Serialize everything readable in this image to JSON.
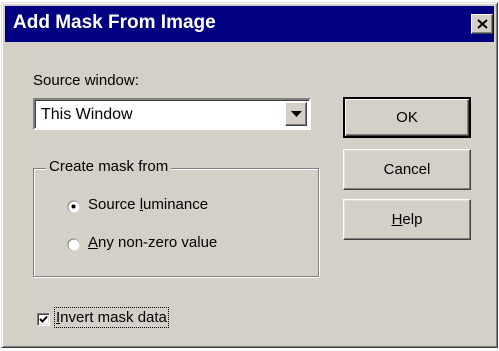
{
  "window": {
    "title": "Add Mask From Image",
    "close_icon": "close-x-icon"
  },
  "source": {
    "label": "Source window:",
    "selected": "This Window",
    "dropdown_icon": "chevron-down-icon"
  },
  "group": {
    "title": "Create mask from",
    "options": [
      {
        "pre": "Source ",
        "accel": "l",
        "post": "uminance",
        "checked": true
      },
      {
        "pre": "",
        "accel": "A",
        "post": "ny non-zero value",
        "checked": false
      }
    ]
  },
  "invert": {
    "accel": "I",
    "rest": "nvert mask data",
    "checked": true
  },
  "buttons": {
    "ok": "OK",
    "cancel": "Cancel",
    "help_accel": "H",
    "help_rest": "elp"
  },
  "colors": {
    "face": "#d4d0c8",
    "title_bar": "#000080",
    "title_text": "#ffffff"
  }
}
